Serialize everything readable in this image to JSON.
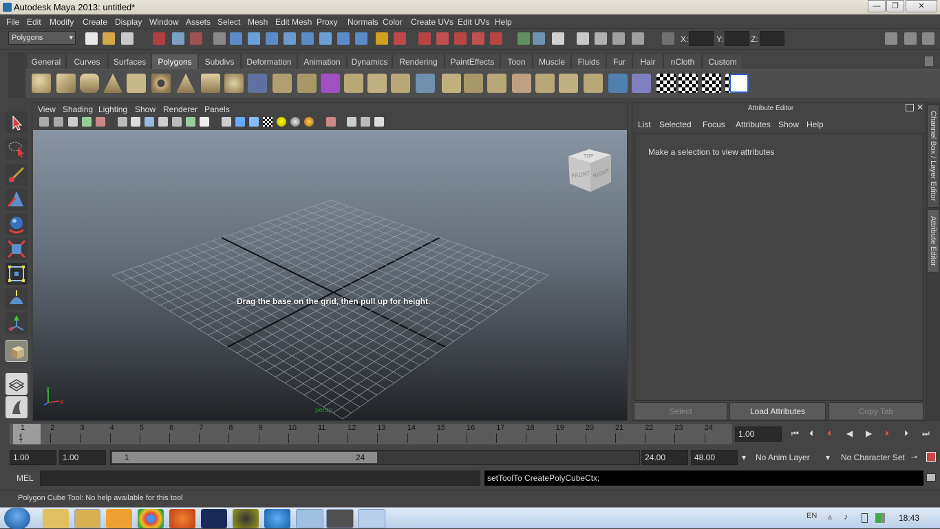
{
  "window": {
    "title": "Autodesk Maya 2013: untitled*",
    "min": "—",
    "max": "❐",
    "close": "✕"
  },
  "menubar": [
    "File",
    "Edit",
    "Modify",
    "Create",
    "Display",
    "Window",
    "Assets",
    "Select",
    "Mesh",
    "Edit Mesh",
    "Proxy",
    "Normals",
    "Color",
    "Create UVs",
    "Edit UVs",
    "Help"
  ],
  "statusline": {
    "mode": "Polygons",
    "x_label": "X:",
    "y_label": "Y:",
    "z_label": "Z:"
  },
  "shelf_tabs": [
    "General",
    "Curves",
    "Surfaces",
    "Polygons",
    "Subdivs",
    "Deformation",
    "Animation",
    "Dynamics",
    "Rendering",
    "PaintEffects",
    "Toon",
    "Muscle",
    "Fluids",
    "Fur",
    "Hair",
    "nCloth",
    "Custom"
  ],
  "active_shelf": "Polygons",
  "viewport": {
    "menu": [
      "View",
      "Shading",
      "Lighting",
      "Show",
      "Renderer",
      "Panels"
    ],
    "hint": "Drag the base on the grid, then pull up for height.",
    "camera_label": "persp",
    "viewcube": {
      "top": "TOP",
      "front": "FRONT",
      "right": "RIGHT"
    },
    "axis": {
      "x": "x",
      "y": "y",
      "z": "z"
    }
  },
  "attribute_editor": {
    "title": "Attribute Editor",
    "menu": [
      "List",
      "Selected",
      "Focus",
      "Attributes",
      "Show",
      "Help"
    ],
    "message": "Make a selection to view attributes",
    "buttons": {
      "select": "Select",
      "load": "Load Attributes",
      "copy": "Copy Tab"
    }
  },
  "side_tabs": {
    "channel_box": "Channel Box / Layer Editor",
    "attribute_editor": "Attribute Editor"
  },
  "timeline": {
    "ticks": [
      "1",
      "2",
      "3",
      "4",
      "5",
      "6",
      "7",
      "8",
      "9",
      "10",
      "11",
      "12",
      "13",
      "14",
      "15",
      "16",
      "17",
      "18",
      "19",
      "20",
      "21",
      "22",
      "23",
      "24"
    ],
    "current_frame": "1",
    "current_field": "1.00"
  },
  "range": {
    "start": "1.00",
    "playback_start": "1.00",
    "slider_start": "1",
    "slider_end": "24",
    "playback_end": "24.00",
    "end": "48.00",
    "anim_layer": "No Anim Layer",
    "character_set": "No Character Set"
  },
  "command": {
    "lang": "MEL",
    "result": "setToolTo CreatePolyCubeCtx;"
  },
  "help_line": "Polygon Cube Tool: No help available for this tool",
  "taskbar": {
    "lang": "EN",
    "time": "18:43"
  }
}
